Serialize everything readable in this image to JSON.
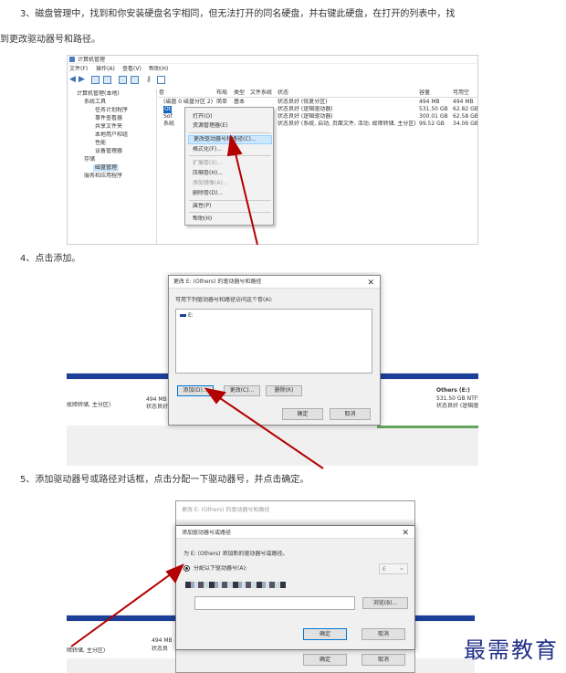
{
  "steps": {
    "s3_line1": "3、磁盘管理中，找到和你安装硬盘名字相同，但无法打开的同名硬盘，并右键此硬盘，在打开的列表中，找",
    "s3_line2": "到更改驱动器号和路径。",
    "s4": "4、点击添加。",
    "s5": "5、添加驱动器号或路径对话框，点击分配一下驱动器号，并点击确定。"
  },
  "cm": {
    "title": "计算机管理",
    "menu": [
      "文件(F)",
      "操作(A)",
      "查看(V)",
      "帮助(H)"
    ],
    "tree": [
      "计算机管理(本地)",
      "系统工具",
      "任务计划程序",
      "事件查看器",
      "共享文件夹",
      "本地用户和组",
      "性能",
      "设备管理器",
      "存储",
      "磁盘管理",
      "服务和应用程序"
    ],
    "columns": [
      "卷",
      "布局",
      "类型",
      "文件系统",
      "状态",
      "容量",
      "可用空"
    ],
    "rows": [
      {
        "vol": "(磁盘 0 磁盘分区 2)",
        "layout": "简单",
        "type": "基本",
        "fs": "",
        "status": "状态良好 (恢复分区)",
        "cap": "494 MB",
        "free": "494 MB"
      },
      {
        "vol": "Ot",
        "layout": "",
        "type": "",
        "fs": "",
        "status": "状态良好 (逻辑驱动器)",
        "cap": "531.50 GB",
        "free": "62.82 GB"
      },
      {
        "vol": "Sof",
        "layout": "",
        "type": "",
        "fs": "",
        "status": "状态良好 (逻辑驱动器)",
        "cap": "300.01 GB",
        "free": "62.58 GB"
      },
      {
        "vol": "系统",
        "layout": "",
        "type": "",
        "fs": "",
        "status": "状态良好 (系统, 启动, 页面文件, 活动, 故障转储, 主分区)",
        "cap": "99.52 GB",
        "free": "34.06 GB"
      }
    ],
    "context_menu": [
      "打开(O)",
      "资源管理器(E)",
      "更改驱动器号和路径(C)...",
      "格式化(F)...",
      "扩展卷(X)...",
      "压缩卷(H)...",
      "添加镜像(A)...",
      "删除卷(D)...",
      "属性(P)",
      "帮助(H)"
    ]
  },
  "dlg1": {
    "title": "更改 E: (Others) 的驱动器号和路径",
    "label": "可用下列驱动器号和路径访问这个卷(A):",
    "item": "E:",
    "add": "添加(D)...",
    "change": "更改(C)...",
    "delete": "删除(R)",
    "ok": "确定",
    "cancel": "取消",
    "bg_left": "494 MB",
    "bg_left2": "状态良好",
    "bg_left3": "故障转储, 主分区)",
    "bg_right_title": "Others  (E:)",
    "bg_right_size": "531.50 GB NTFS",
    "bg_right_status": "状态良好 (逻辑驱"
  },
  "dlg2": {
    "outer_title": "更改 E: (Others) 的驱动器号和路径",
    "title": "添加驱动器号或路径",
    "for_text": "为 E: (Others) 添加新的驱动器号或路径。",
    "assign": "分配以下驱动器号(A):",
    "drive": "E",
    "browse": "浏览(B)...",
    "ok": "确定",
    "cancel": "取消",
    "outer_ok": "确定",
    "outer_cancel": "取消",
    "bg_left": "494 MB",
    "bg_left2": "状态良",
    "bg_left3": "障转储, 主分区)"
  },
  "watermark": "最需教育"
}
